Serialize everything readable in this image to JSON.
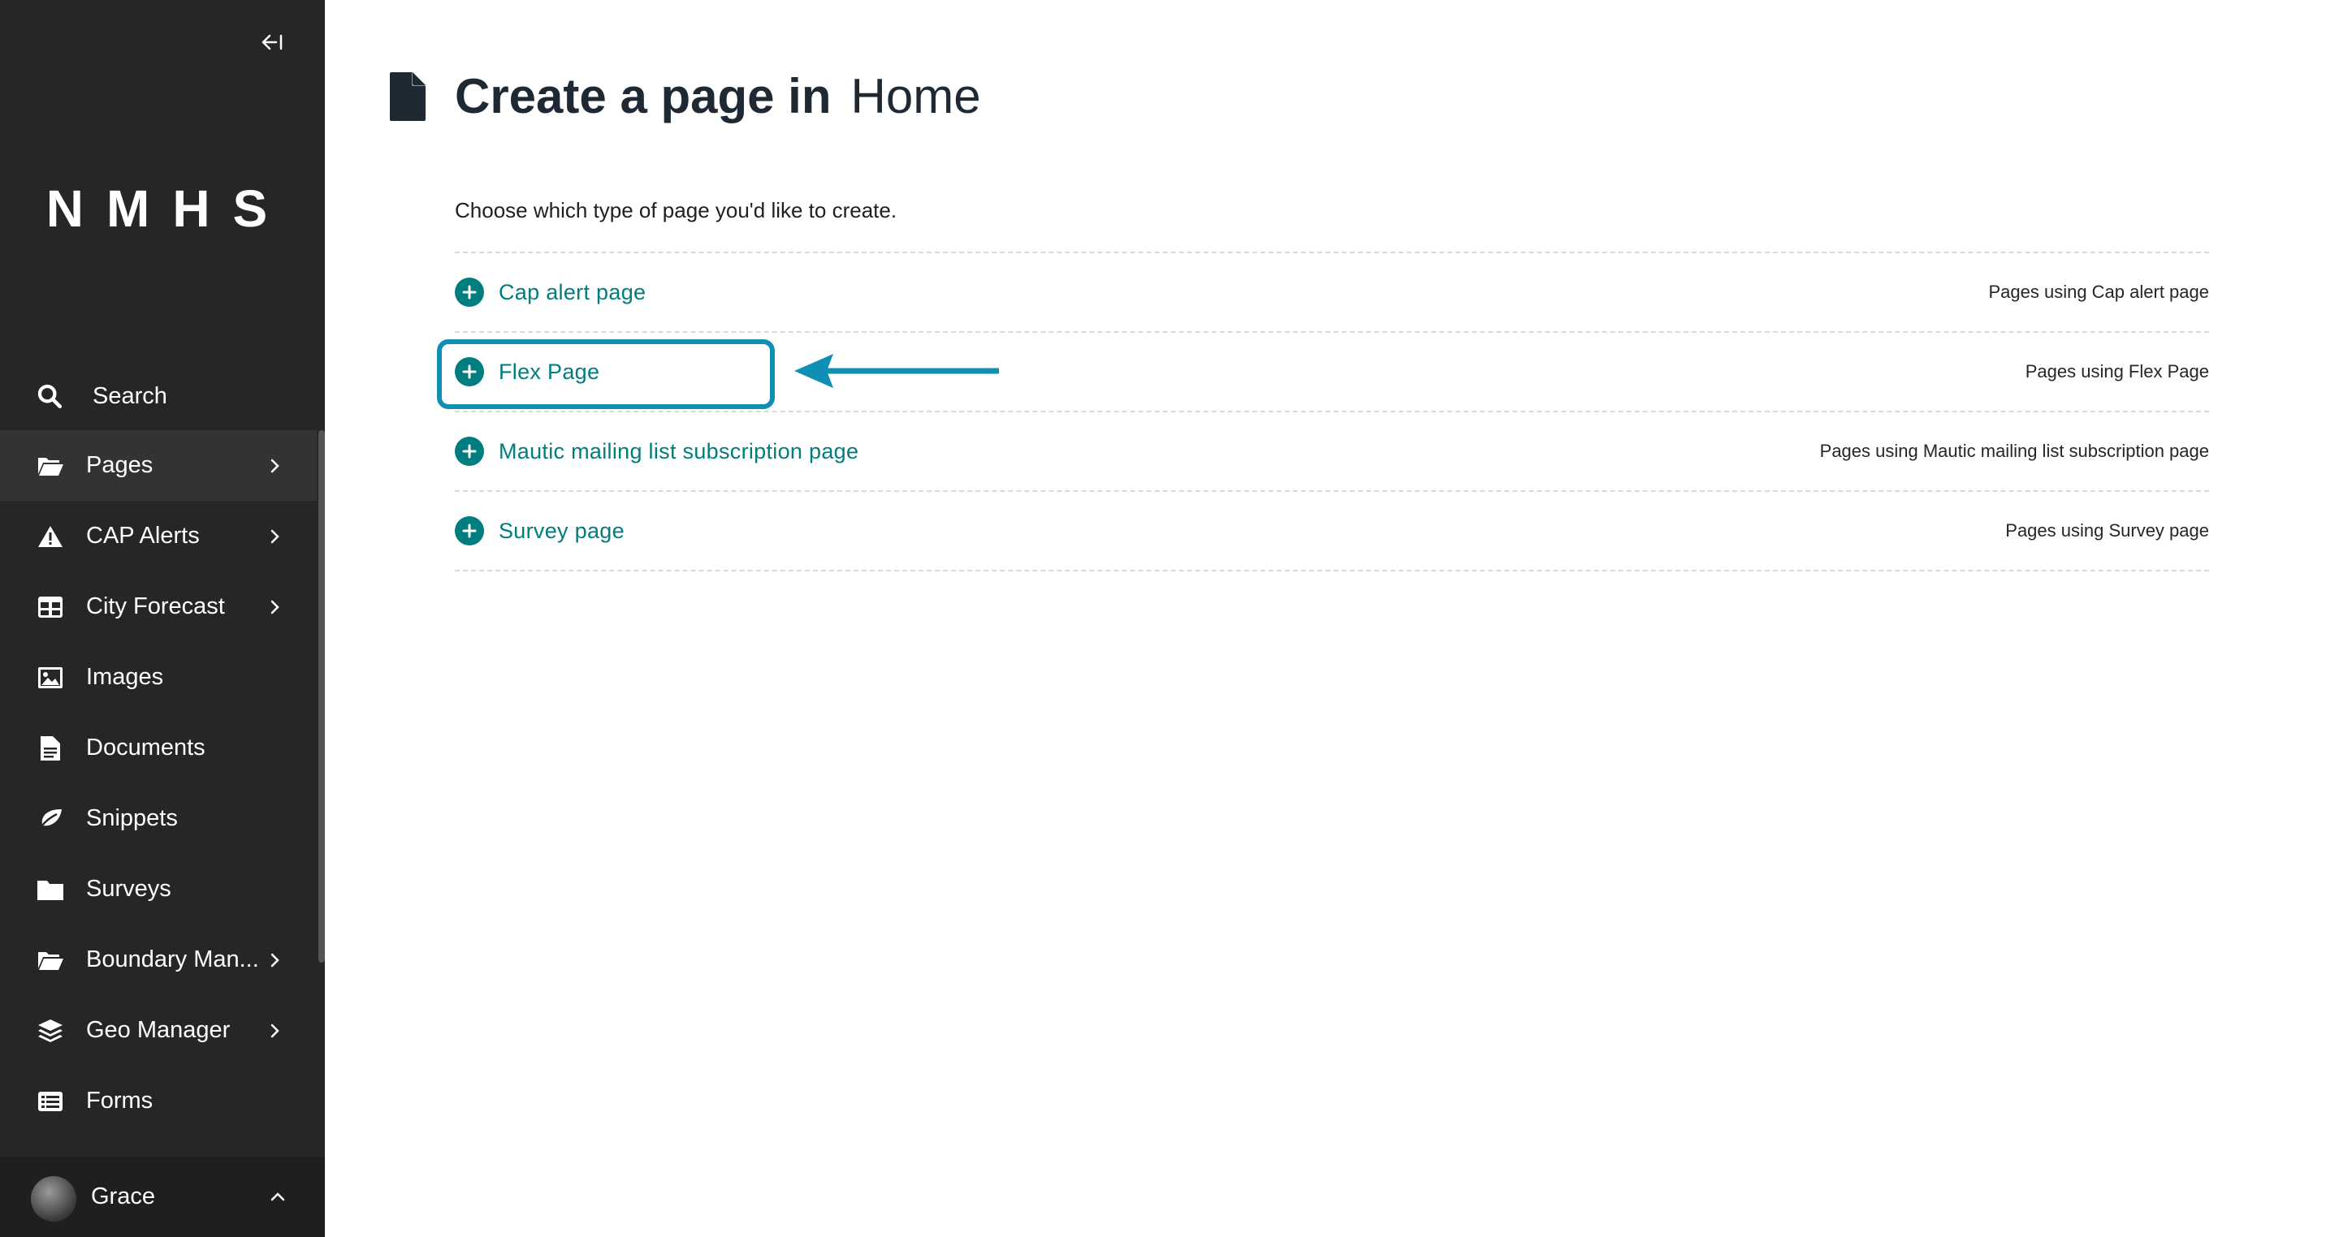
{
  "sidebar": {
    "logo": "NMHS",
    "search_label": "Search",
    "items": [
      {
        "label": "Pages",
        "icon": "folder-open-icon",
        "has_submenu": true
      },
      {
        "label": "CAP Alerts",
        "icon": "warning-icon",
        "has_submenu": true
      },
      {
        "label": "City Forecast",
        "icon": "table-icon",
        "has_submenu": true
      },
      {
        "label": "Images",
        "icon": "image-icon",
        "has_submenu": false
      },
      {
        "label": "Documents",
        "icon": "document-icon",
        "has_submenu": false
      },
      {
        "label": "Snippets",
        "icon": "leaf-icon",
        "has_submenu": false
      },
      {
        "label": "Surveys",
        "icon": "folder-icon",
        "has_submenu": false
      },
      {
        "label": "Boundary Man...",
        "icon": "folder-open-icon",
        "has_submenu": true
      },
      {
        "label": "Geo Manager",
        "icon": "layers-icon",
        "has_submenu": true
      },
      {
        "label": "Forms",
        "icon": "list-icon",
        "has_submenu": false
      }
    ],
    "account_name": "Grace"
  },
  "header": {
    "title": "Create a page in",
    "subtitle": "Home"
  },
  "intro": "Choose which type of page you'd like to create.",
  "page_types": [
    {
      "label": "Cap alert page",
      "meta": "Pages using Cap alert page"
    },
    {
      "label": "Flex Page",
      "meta": "Pages using Flex Page"
    },
    {
      "label": "Mautic mailing list subscription page",
      "meta": "Pages using Mautic mailing list subscription page"
    },
    {
      "label": "Survey page",
      "meta": "Pages using Survey page"
    }
  ],
  "annotation": {
    "highlighted_item": "Flex Page",
    "color": "#0f8fb5"
  },
  "colors": {
    "sidebar_bg": "#262626",
    "accent": "#007d7e",
    "title": "#1f2933"
  }
}
